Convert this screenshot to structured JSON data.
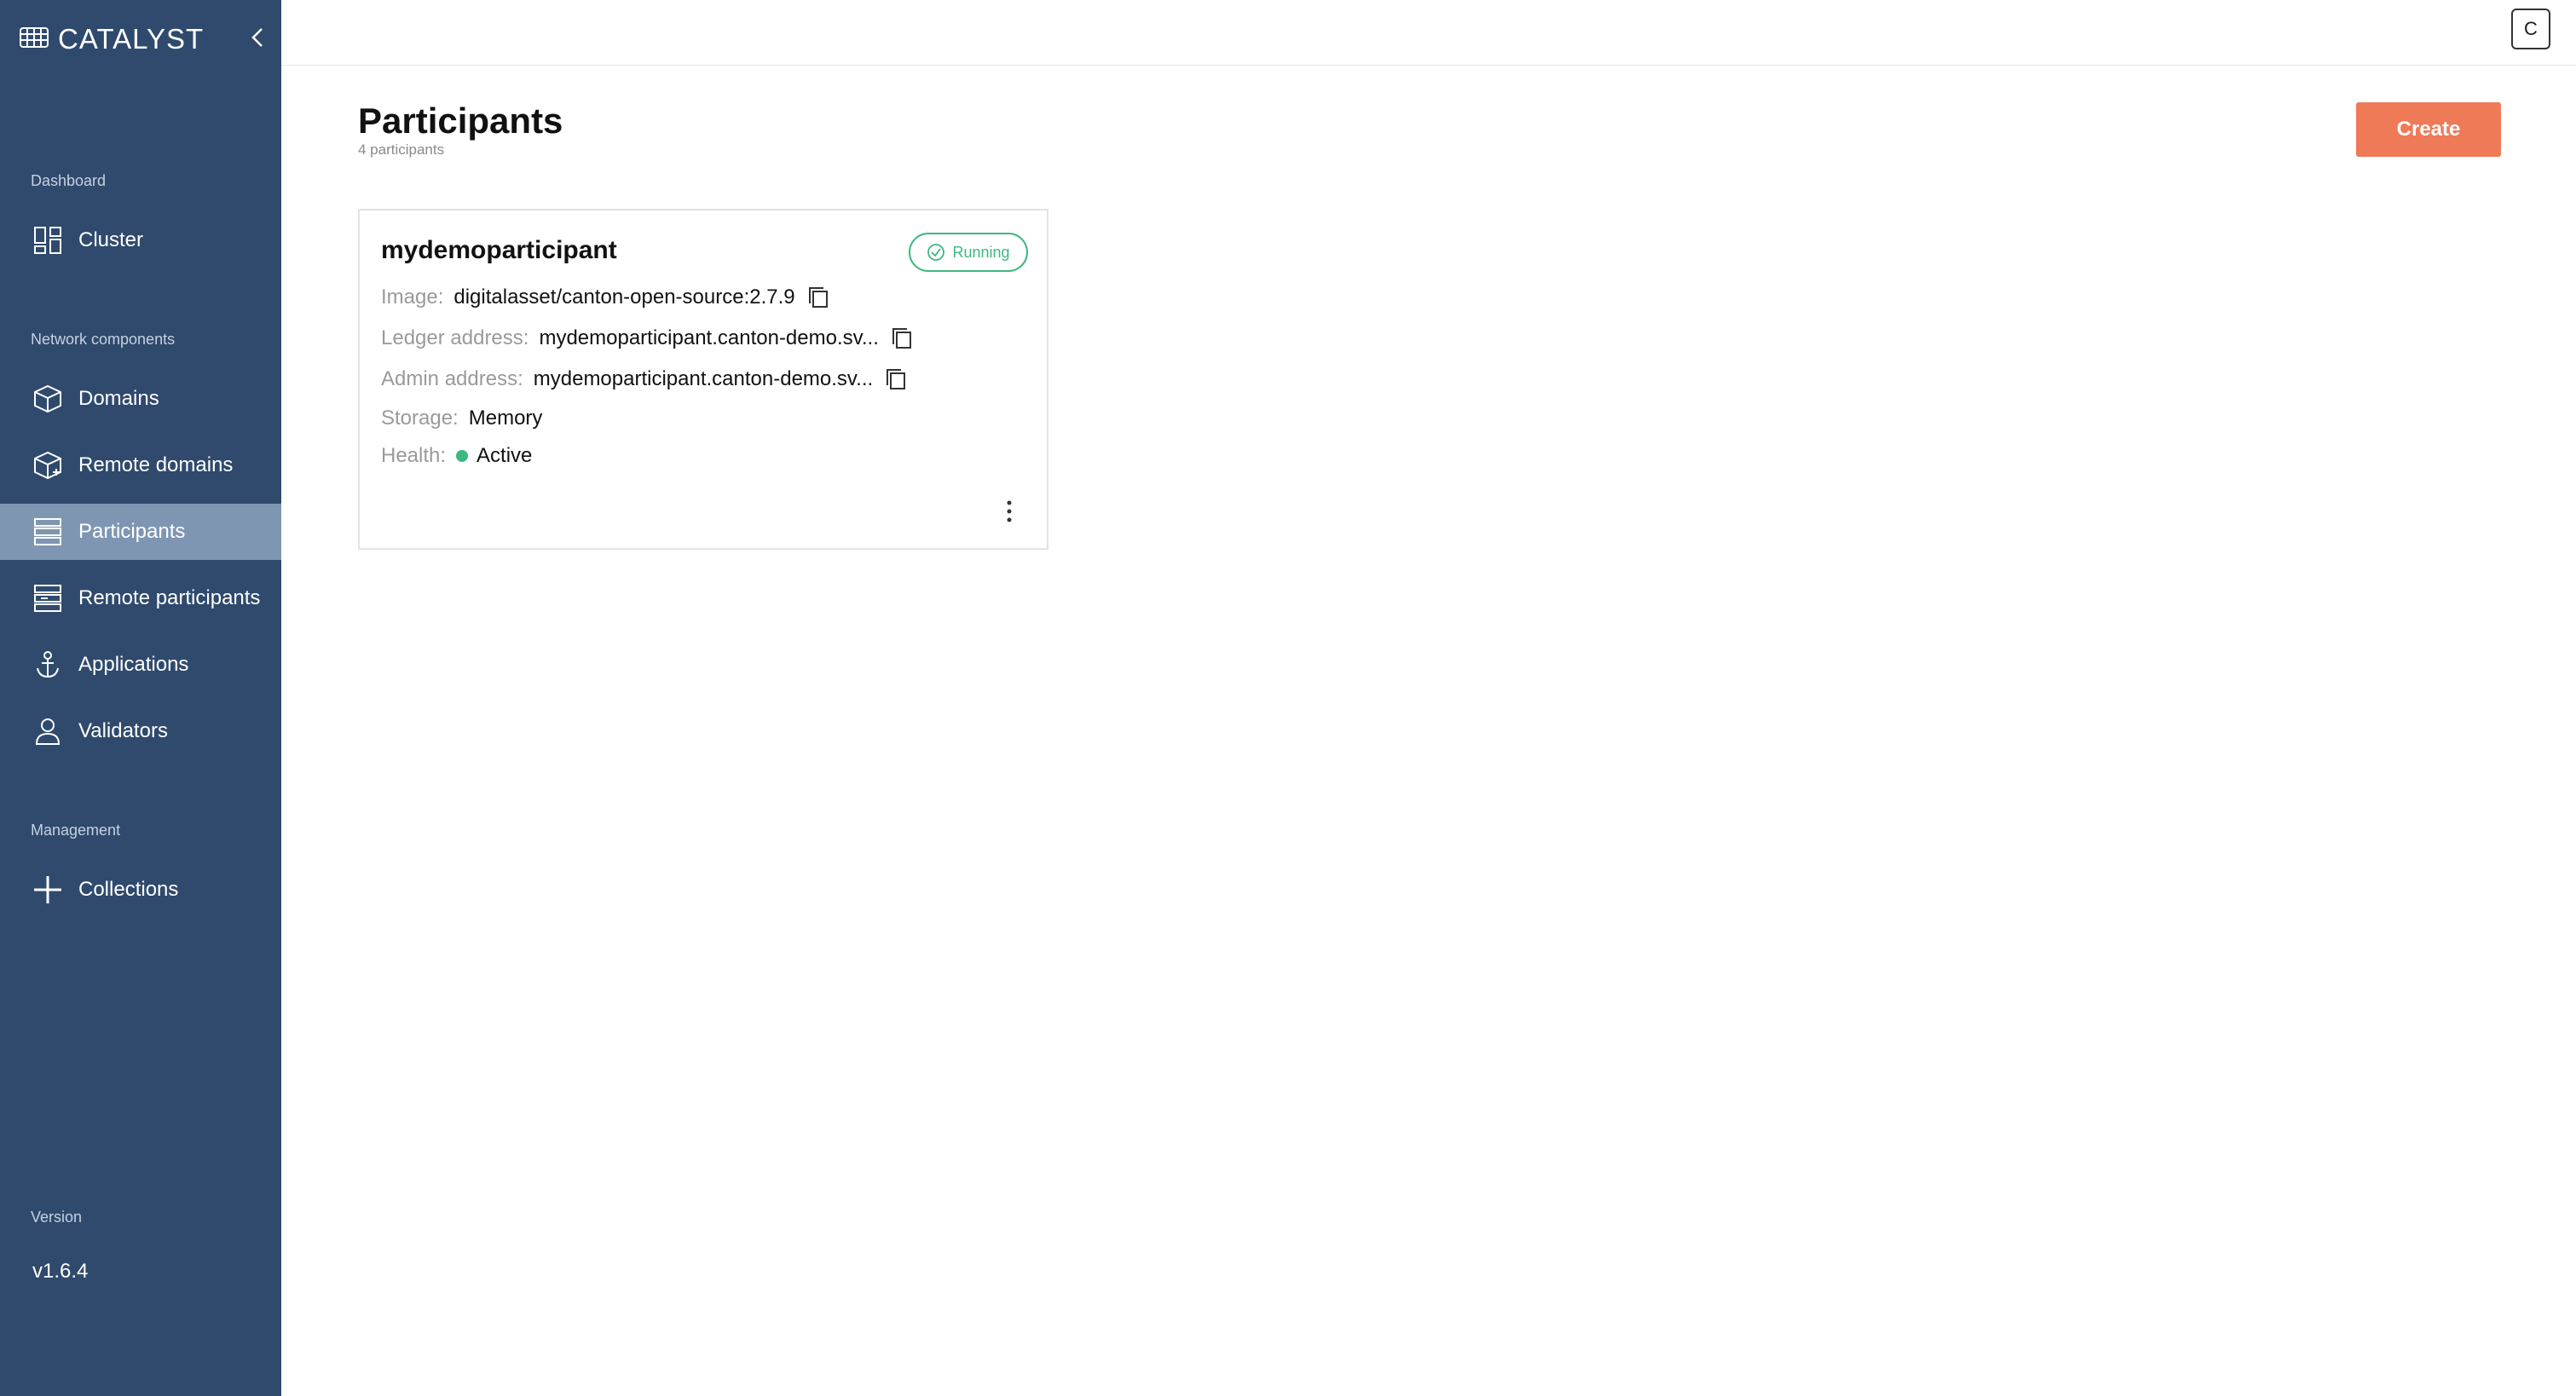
{
  "brand": {
    "name": "CATALYST"
  },
  "colors": {
    "sidebar": "#2f4a6d",
    "active": "#7f96b3",
    "accent": "#ef7a58",
    "status": "#3cb882"
  },
  "sidebar": {
    "sections": {
      "dashboard": "Dashboard",
      "network": "Network components",
      "management": "Management",
      "version": "Version"
    },
    "items": [
      {
        "label": "Cluster",
        "icon": "grid-icon"
      },
      {
        "label": "Domains",
        "icon": "cube-icon"
      },
      {
        "label": "Remote domains",
        "icon": "cube-link-icon"
      },
      {
        "label": "Participants",
        "icon": "server-icon"
      },
      {
        "label": "Remote participants",
        "icon": "server-link-icon"
      },
      {
        "label": "Applications",
        "icon": "anchor-icon"
      },
      {
        "label": "Validators",
        "icon": "user-icon"
      },
      {
        "label": "Collections",
        "icon": "plus-icon"
      }
    ],
    "version_value": "v1.6.4"
  },
  "topbar": {
    "avatar_initial": "C"
  },
  "main": {
    "title": "Participants",
    "subtitle": "4 participants",
    "create_label": "Create"
  },
  "card": {
    "name": "mydemoparticipant",
    "status": "Running",
    "image_label": "Image:",
    "image_value": "digitalasset/canton-open-source:2.7.9",
    "ledger_label": "Ledger address:",
    "ledger_value": "mydemoparticipant.canton-demo.sv...",
    "admin_label": "Admin address:",
    "admin_value": "mydemoparticipant.canton-demo.sv...",
    "storage_label": "Storage:",
    "storage_value": "Memory",
    "health_label": "Health:",
    "health_value": "Active"
  }
}
